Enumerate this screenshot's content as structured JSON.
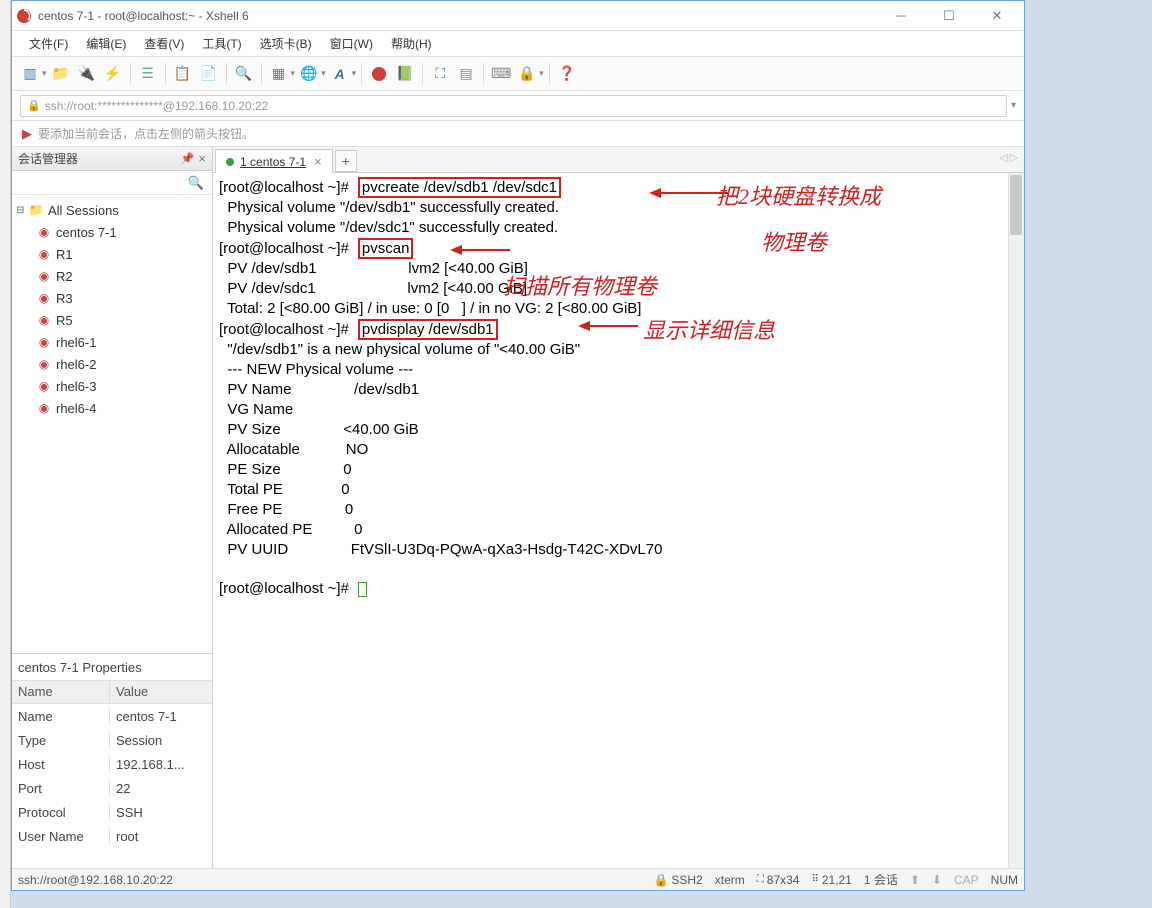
{
  "title": "centos 7-1 - root@localhost:~ - Xshell 6",
  "menu": [
    "文件(F)",
    "编辑(E)",
    "查看(V)",
    "工具(T)",
    "选项卡(B)",
    "窗口(W)",
    "帮助(H)"
  ],
  "address": "ssh://root:**************@192.168.10.20:22",
  "hint": "要添加当前会话，点击左侧的箭头按钮。",
  "sidebar_title": "会话管理器",
  "tree_root": "All Sessions",
  "sessions": [
    "centos 7-1",
    "R1",
    "R2",
    "R3",
    "R5",
    "rhel6-1",
    "rhel6-2",
    "rhel6-3",
    "rhel6-4"
  ],
  "props_title": "centos 7-1 Properties",
  "props_cols": [
    "Name",
    "Value"
  ],
  "props": [
    [
      "Name",
      "centos 7-1"
    ],
    [
      "Type",
      "Session"
    ],
    [
      "Host",
      "192.168.1..."
    ],
    [
      "Port",
      "22"
    ],
    [
      "Protocol",
      "SSH"
    ],
    [
      "User Name",
      "root"
    ]
  ],
  "tab": {
    "label": "centos 7-1",
    "num": "1"
  },
  "term": {
    "prompt": "[root@localhost ~]#",
    "cmd1": "pvcreate /dev/sdb1 /dev/sdc1",
    "l2": "  Physical volume \"/dev/sdb1\" successfully created.",
    "l3": "  Physical volume \"/dev/sdc1\" successfully created.",
    "cmd2": "pvscan",
    "l5": "  PV /dev/sdb1                      lvm2 [<40.00 GiB]",
    "l6": "  PV /dev/sdc1                      lvm2 [<40.00 GiB]",
    "l7": "  Total: 2 [<80.00 GiB] / in use: 0 [0   ] / in no VG: 2 [<80.00 GiB]",
    "cmd3": "pvdisplay /dev/sdb1",
    "l9": "  \"/dev/sdb1\" is a new physical volume of \"<40.00 GiB\"",
    "l10": "  --- NEW Physical volume ---",
    "l11": "  PV Name               /dev/sdb1",
    "l12": "  VG Name               ",
    "l13": "  PV Size               <40.00 GiB",
    "l14": "  Allocatable           NO",
    "l15": "  PE Size               0   ",
    "l16": "  Total PE              0",
    "l17": "  Free PE               0",
    "l18": "  Allocated PE          0",
    "l19": "  PV UUID               FtVSlI-U3Dq-PQwA-qXa3-Hsdg-T42C-XDvL70",
    "anno1a": "把2块硬盘转换成",
    "anno1b": "物理卷",
    "anno2": "扫描所有物理卷",
    "anno3": "显示详细信息"
  },
  "status": {
    "left": "ssh://root@192.168.10.20:22",
    "proto": "SSH2",
    "term": "xterm",
    "size": "87x34",
    "pos": "21,21",
    "sess": "1 会话",
    "cap": "CAP",
    "num": "NUM"
  }
}
